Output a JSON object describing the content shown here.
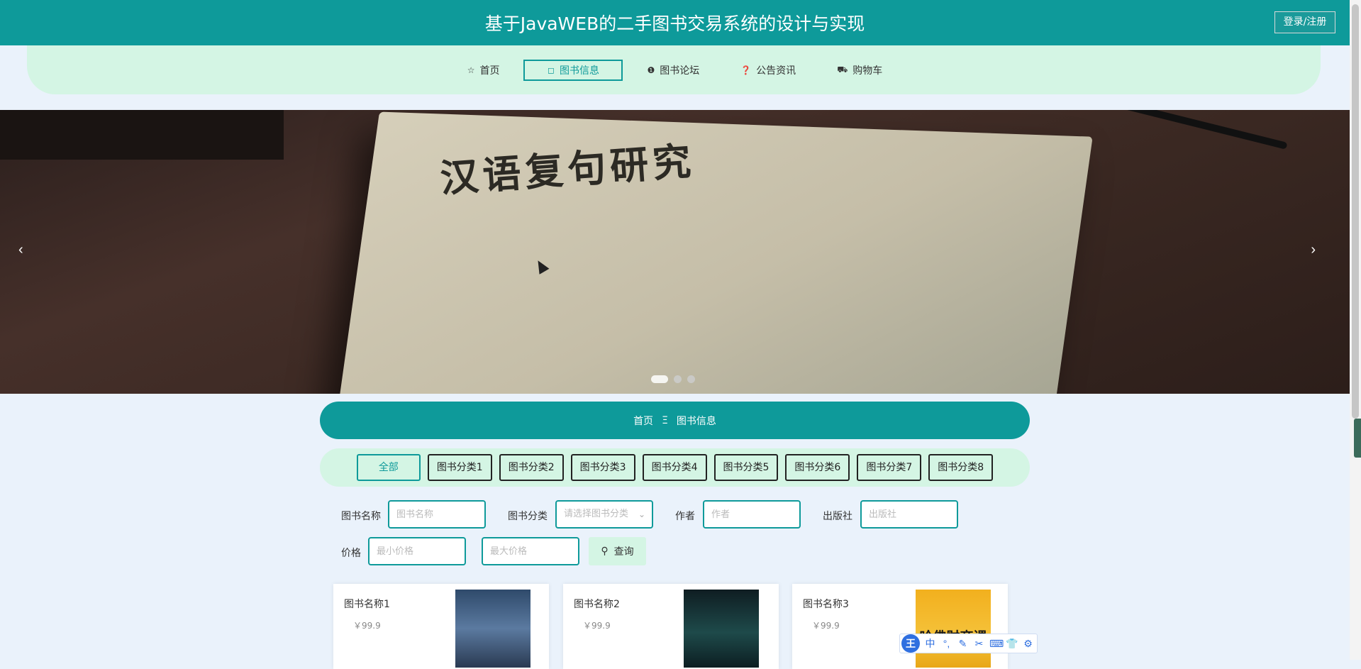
{
  "header": {
    "title": "基于JavaWEB的二手图书交易系统的设计与实现",
    "login_label": "登录/注册"
  },
  "nav": {
    "items": [
      {
        "label": "首页",
        "icon": "star-icon",
        "glyph": "☆"
      },
      {
        "label": "图书信息",
        "icon": "bag-icon",
        "glyph": "◻"
      },
      {
        "label": "图书论坛",
        "icon": "alert-icon",
        "glyph": "❶"
      },
      {
        "label": "公告资讯",
        "icon": "question-icon",
        "glyph": "❓"
      },
      {
        "label": "购物车",
        "icon": "cart-icon",
        "glyph": "⛟"
      }
    ],
    "active_index": 1
  },
  "banner": {
    "book_title": "汉语复句研究",
    "slides": 3,
    "active_slide": 0,
    "prev_glyph": "‹",
    "next_glyph": "›"
  },
  "breadcrumb": {
    "home": "首页",
    "separator": "Ξ",
    "current": "图书信息"
  },
  "categories": {
    "items": [
      "全部",
      "图书分类1",
      "图书分类2",
      "图书分类3",
      "图书分类4",
      "图书分类5",
      "图书分类6",
      "图书分类7",
      "图书分类8"
    ],
    "active_index": 0
  },
  "search": {
    "name_label": "图书名称",
    "name_placeholder": "图书名称",
    "category_label": "图书分类",
    "category_placeholder": "请选择图书分类",
    "author_label": "作者",
    "author_placeholder": "作者",
    "publisher_label": "出版社",
    "publisher_placeholder": "出版社",
    "price_label": "价格",
    "min_price_placeholder": "最小价格",
    "max_price_placeholder": "最大价格",
    "submit_label": "查询"
  },
  "books": [
    {
      "name": "图书名称1",
      "price": "￥99.9"
    },
    {
      "name": "图书名称2",
      "price": "￥99.9"
    },
    {
      "name": "图书名称3",
      "price": "￥99.9",
      "cover_text": "哈佛财商课"
    }
  ],
  "ime": {
    "logo": "王",
    "items": [
      "中",
      "°,",
      "✎",
      "✂",
      "⌨",
      "👕",
      "⚙"
    ]
  },
  "colors": {
    "primary": "#0e9a9a",
    "mint": "#d4f5e4",
    "page_bg": "#eaf2fb"
  }
}
